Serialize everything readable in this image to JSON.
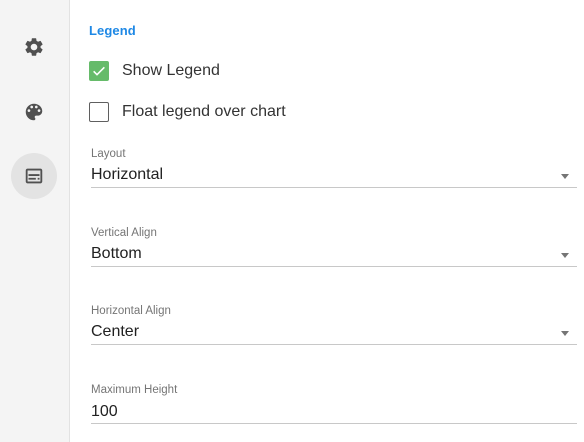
{
  "sidebar": {
    "items": [
      {
        "icon": "gear-icon",
        "active": false
      },
      {
        "icon": "palette-icon",
        "active": false
      },
      {
        "icon": "legend-icon",
        "active": true
      }
    ]
  },
  "legend_section": {
    "title": "Legend",
    "show_legend": {
      "label": "Show Legend",
      "checked": true
    },
    "float_legend": {
      "label": "Float legend over chart",
      "checked": false
    },
    "layout": {
      "label": "Layout",
      "value": "Horizontal"
    },
    "vertical_align": {
      "label": "Vertical Align",
      "value": "Bottom"
    },
    "horizontal_align": {
      "label": "Horizontal Align",
      "value": "Center"
    },
    "max_height": {
      "label": "Maximum Height",
      "value": "100"
    }
  },
  "colors": {
    "accent": "#1e88e5",
    "checkbox_checked": "#66bb6a"
  }
}
